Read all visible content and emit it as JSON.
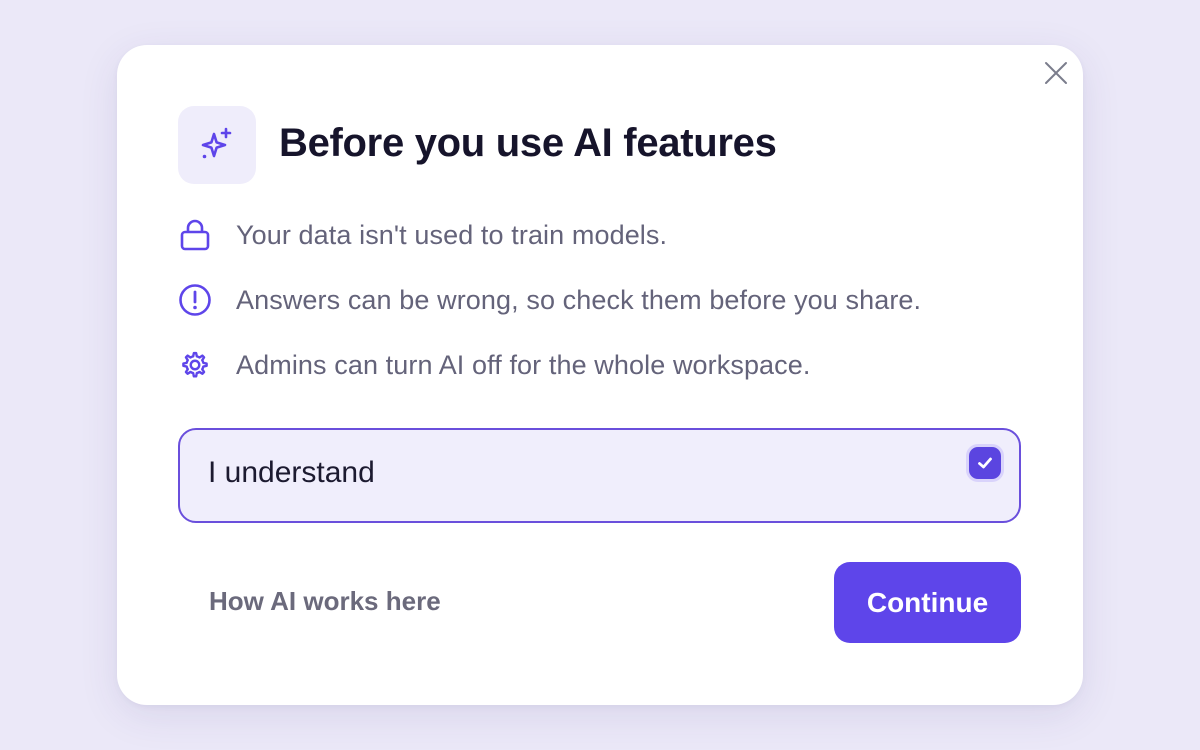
{
  "dialog": {
    "title": "Before you use AI features",
    "header_icon": "sparkles-icon",
    "close_icon": "close-icon"
  },
  "bullets": [
    {
      "icon": "lock-icon",
      "text": "Your data isn't used to train models."
    },
    {
      "icon": "alert-circle-icon",
      "text": "Answers can be wrong, so check them before you share."
    },
    {
      "icon": "gear-icon",
      "text": "Admins can turn AI off for the whole workspace."
    }
  ],
  "acknowledge": {
    "label": "I understand",
    "checked": true
  },
  "footer": {
    "secondary_label": "How AI works here",
    "primary_label": "Continue"
  },
  "colors": {
    "accent": "#5e45ea",
    "background": "#ebe8f8",
    "title": "#16142b",
    "body_text": "#64637a"
  }
}
